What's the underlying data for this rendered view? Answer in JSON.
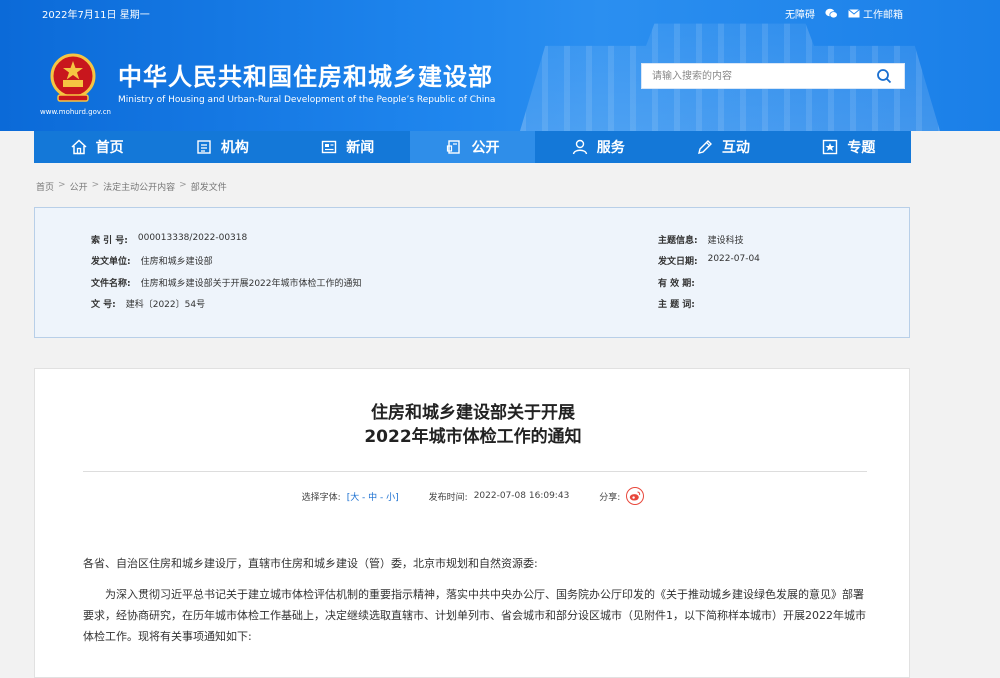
{
  "header": {
    "date": "2022年7月11日 星期一",
    "accessibility": "无障碍",
    "work_mailbox": "工作邮箱",
    "title_cn": "中华人民共和国住房和城乡建设部",
    "title_en": "Ministry of Housing and Urban-Rural Development of the People’s Republic of China",
    "site_url": "www.mohurd.gov.cn",
    "search_placeholder": "请输入搜索的内容"
  },
  "nav": {
    "items": [
      {
        "label": "首页",
        "icon": "home-icon"
      },
      {
        "label": "机构",
        "icon": "org-icon"
      },
      {
        "label": "新闻",
        "icon": "news-icon"
      },
      {
        "label": "公开",
        "icon": "open-icon",
        "active": true
      },
      {
        "label": "服务",
        "icon": "service-icon"
      },
      {
        "label": "互动",
        "icon": "interact-icon"
      },
      {
        "label": "专题",
        "icon": "topic-icon"
      }
    ]
  },
  "breadcrumb": [
    "首页",
    "公开",
    "法定主动公开内容",
    "部发文件"
  ],
  "meta": {
    "index_no_label": "索 引 号:",
    "index_no": "000013338/2022-00318",
    "issuer_label": "发文单位:",
    "issuer": "住房和城乡建设部",
    "doc_name_label": "文件名称:",
    "doc_name": "住房和城乡建设部关于开展2022年城市体检工作的通知",
    "doc_no_label": "文 号:",
    "doc_no": "建科〔2022〕54号",
    "topic_label": "主题信息:",
    "topic": "建设科技",
    "issue_date_label": "发文日期:",
    "issue_date": "2022-07-04",
    "validity_label": "有 效 期:",
    "validity": "",
    "keywords_label": "主 题 词:",
    "keywords": ""
  },
  "article": {
    "title_line1": "住房和城乡建设部关于开展",
    "title_line2": "2022年城市体检工作的通知",
    "font_label": "选择字体:",
    "font_options": "[大 - 中 - 小]",
    "publish_label": "发布时间:",
    "publish_time": "2022-07-08 16:09:43",
    "share_label": "分享:",
    "addressee": "各省、自治区住房和城乡建设厅，直辖市住房和城乡建设（管）委，北京市规划和自然资源委:",
    "paragraph1": "为深入贯彻习近平总书记关于建立城市体检评估机制的重要指示精神，落实中共中央办公厅、国务院办公厅印发的《关于推动城乡建设绿色发展的意见》部署要求，经协商研究，在历年城市体检工作基础上，决定继续选取直辖市、计划单列市、省会城市和部分设区城市（见附件1，以下简称样本城市）开展2022年城市体检工作。现将有关事项通知如下:"
  },
  "colors": {
    "header_blue": "#1f86ee",
    "nav_blue": "#1478d8",
    "nav_active": "#2f8ee9",
    "meta_bg": "#eef4fb",
    "link_blue": "#1a6fd0"
  }
}
